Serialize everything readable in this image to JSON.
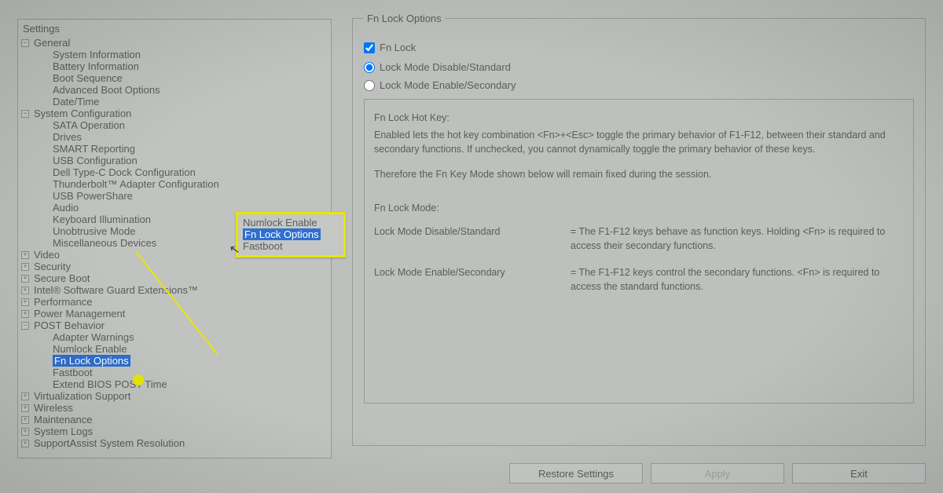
{
  "tree_title": "Settings",
  "tree": [
    {
      "label": "General",
      "expanded": true,
      "children": [
        "System Information",
        "Battery Information",
        "Boot Sequence",
        "Advanced Boot Options",
        "Date/Time"
      ]
    },
    {
      "label": "System Configuration",
      "expanded": true,
      "children": [
        "SATA Operation",
        "Drives",
        "SMART Reporting",
        "USB Configuration",
        "Dell Type-C Dock Configuration",
        "Thunderbolt™ Adapter Configuration",
        "USB PowerShare",
        "Audio",
        "Keyboard Illumination",
        "Unobtrusive Mode",
        "Miscellaneous Devices"
      ]
    },
    {
      "label": "Video",
      "expanded": false
    },
    {
      "label": "Security",
      "expanded": false
    },
    {
      "label": "Secure Boot",
      "expanded": false
    },
    {
      "label": "Intel® Software Guard Extensions™",
      "expanded": false
    },
    {
      "label": "Performance",
      "expanded": false
    },
    {
      "label": "Power Management",
      "expanded": false
    },
    {
      "label": "POST Behavior",
      "expanded": true,
      "children": [
        "Adapter Warnings",
        "Numlock Enable",
        "Fn Lock Options",
        "Fastboot",
        "Extend BIOS POST Time"
      ]
    },
    {
      "label": "Virtualization Support",
      "expanded": false
    },
    {
      "label": "Wireless",
      "expanded": false
    },
    {
      "label": "Maintenance",
      "expanded": false
    },
    {
      "label": "System Logs",
      "expanded": false
    },
    {
      "label": "SupportAssist System Resolution",
      "expanded": false
    }
  ],
  "selected_path": "POST Behavior > Fn Lock Options",
  "right": {
    "legend": "Fn Lock Options",
    "checkbox_label": "Fn Lock",
    "checkbox_checked": true,
    "radio1_label": "Lock Mode Disable/Standard",
    "radio2_label": "Lock Mode Enable/Secondary",
    "radio_selected": 0,
    "desc": {
      "heading1": "Fn Lock Hot Key:",
      "p1": "Enabled lets the hot key combination <Fn>+<Esc> toggle the primary behavior of F1-F12, between their standard and secondary functions. If unchecked, you cannot dynamically toggle the primary behavior of these keys.",
      "p2": "Therefore the Fn Key Mode shown below will remain fixed during the session.",
      "heading2": "Fn Lock Mode:",
      "mode1_name": "Lock Mode Disable/Standard",
      "mode1_text": "The F1-F12 keys behave as function keys. Holding <Fn> is required to access their secondary functions.",
      "mode2_name": "Lock Mode Enable/Secondary",
      "mode2_text": "The F1-F12 keys control the secondary functions. <Fn> is required to access the standard functions."
    }
  },
  "callout": {
    "items": [
      "Numlock Enable",
      "Fn Lock Options",
      "Fastboot"
    ],
    "highlight_index": 1
  },
  "buttons": {
    "restore": "Restore Settings",
    "apply": "Apply",
    "exit": "Exit"
  }
}
